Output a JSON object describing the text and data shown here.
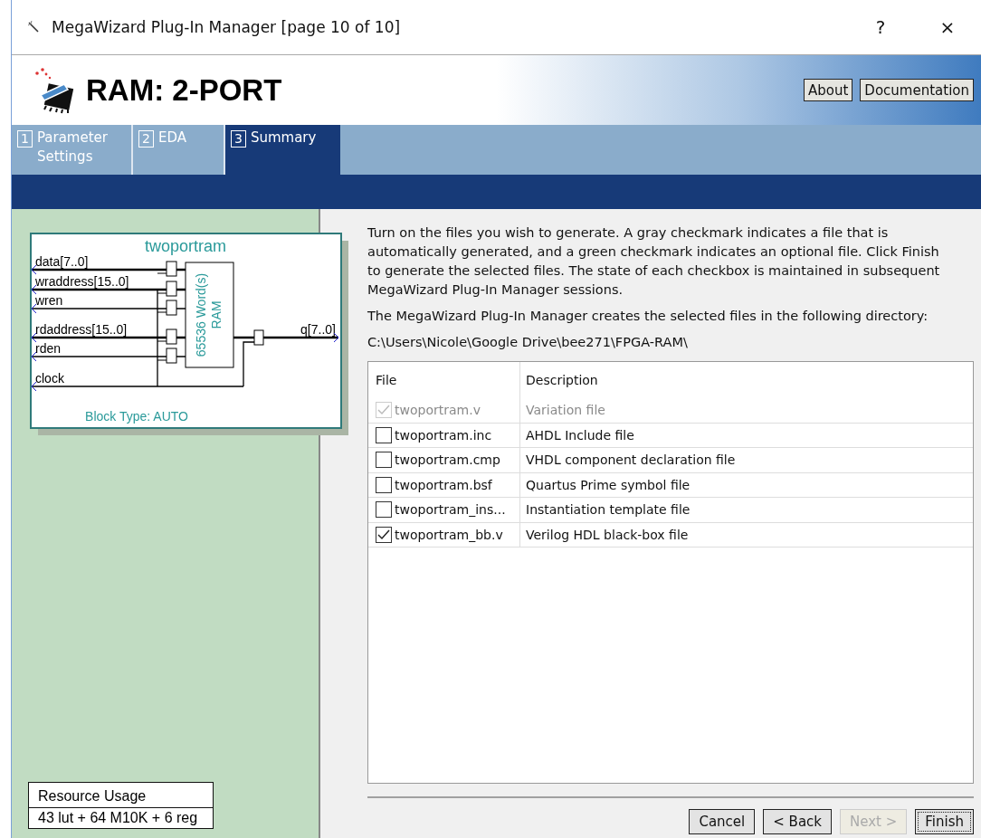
{
  "window": {
    "title": "MegaWizard Plug-In Manager [page 10 of 10]",
    "help": "?",
    "close": "×"
  },
  "header": {
    "title": "RAM: 2-PORT",
    "buttons": [
      "About",
      "Documentation"
    ]
  },
  "tabs": [
    {
      "number": "1",
      "label": "Parameter Settings",
      "selected": false
    },
    {
      "number": "2",
      "label": "EDA",
      "selected": false
    },
    {
      "number": "3",
      "label": "Summary",
      "selected": true
    }
  ],
  "diagram": {
    "title": "twoportram",
    "inputs": [
      {
        "name": "data[7..0]",
        "bus": true,
        "kind": "signal"
      },
      {
        "name": "wraddress[15..0]",
        "bus": true,
        "kind": "signal"
      },
      {
        "name": "wren",
        "bus": false,
        "kind": "signal"
      },
      {
        "name": "rdaddress[15..0]",
        "bus": true,
        "kind": "signal"
      },
      {
        "name": "rden",
        "bus": false,
        "kind": "signal"
      },
      {
        "name": "clock",
        "bus": false,
        "kind": "clock"
      }
    ],
    "block": [
      "65536 Word(s)",
      "RAM"
    ],
    "output": "q[7..0]",
    "block_type": "Block Type: AUTO"
  },
  "resource_usage": {
    "title": "Resource Usage",
    "value": "43 lut + 64 M10K + 6 reg"
  },
  "instructions": "Turn on the files you wish to generate. A gray checkmark indicates a file that is automatically generated, and a green checkmark indicates an optional file. Click Finish to generate the selected files. The state of each checkbox is maintained in subsequent MegaWizard Plug-In Manager sessions.",
  "directory_note": "The MegaWizard Plug-In Manager creates the selected files in the following directory:",
  "directory": "C:\\Users\\Nicole\\Google Drive\\bee271\\FPGA-RAM\\",
  "table": {
    "columns": [
      "File",
      "Description"
    ],
    "rows": [
      {
        "file": "twoportram.v",
        "description": "Variation file",
        "checked": true,
        "disabled": true
      },
      {
        "file": "twoportram.inc",
        "description": "AHDL Include file",
        "checked": false,
        "disabled": false
      },
      {
        "file": "twoportram.cmp",
        "description": "VHDL component declaration file",
        "checked": false,
        "disabled": false
      },
      {
        "file": "twoportram.bsf",
        "description": "Quartus Prime symbol file",
        "checked": false,
        "disabled": false
      },
      {
        "file": "twoportram_ins...",
        "description": "Instantiation template file",
        "checked": false,
        "disabled": false
      },
      {
        "file": "twoportram_bb.v",
        "description": "Verilog HDL black-box file",
        "checked": true,
        "disabled": false
      }
    ]
  },
  "buttons": [
    {
      "label": "Cancel",
      "disabled": false,
      "focused": false
    },
    {
      "label": "< Back",
      "disabled": false,
      "focused": false
    },
    {
      "label": "Next >",
      "disabled": true,
      "focused": false
    },
    {
      "label": "Finish",
      "disabled": false,
      "focused": true
    }
  ]
}
